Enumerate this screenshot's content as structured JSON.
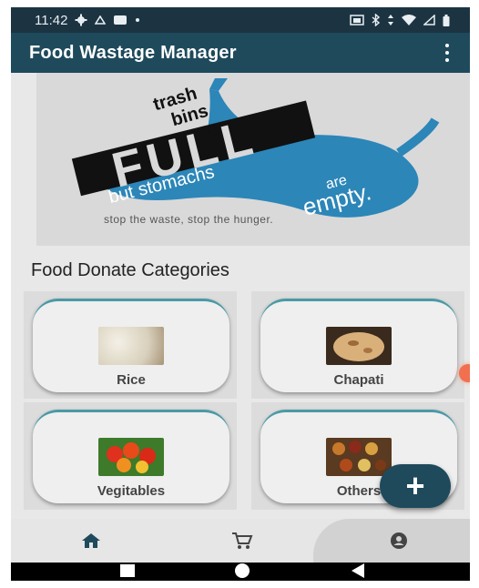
{
  "status_bar": {
    "time": "11:42",
    "left_icons": [
      "settings-icon",
      "notification-icon",
      "messages-icon",
      "dot-icon"
    ],
    "right_icons": [
      "cast-icon",
      "bluetooth-icon",
      "data-arrows-icon",
      "wifi-icon",
      "signal-icon",
      "battery-icon"
    ]
  },
  "app_bar": {
    "title": "Food Wastage Manager",
    "menu_icon": "more-vert-icon"
  },
  "banner": {
    "line1": "trash",
    "line2": "bins",
    "line3": "are",
    "headline": "FULL",
    "subline": "but stomachs",
    "are": "are",
    "empty": "empty.",
    "tagline": "stop the waste, stop the hunger."
  },
  "section": {
    "title": "Food Donate Categories"
  },
  "categories": [
    {
      "label": "Rice"
    },
    {
      "label": "Chapati"
    },
    {
      "label": "Vegitables"
    },
    {
      "label": "Others"
    }
  ],
  "fab": {
    "label": "+"
  },
  "bottom_nav": [
    "home-icon",
    "cart-icon",
    "account-icon"
  ],
  "colors": {
    "app_bar": "#1e4a5c",
    "status_bar": "#1c3442",
    "card_accent": "#4a9aa6",
    "banner_blue": "#2c86b8"
  }
}
